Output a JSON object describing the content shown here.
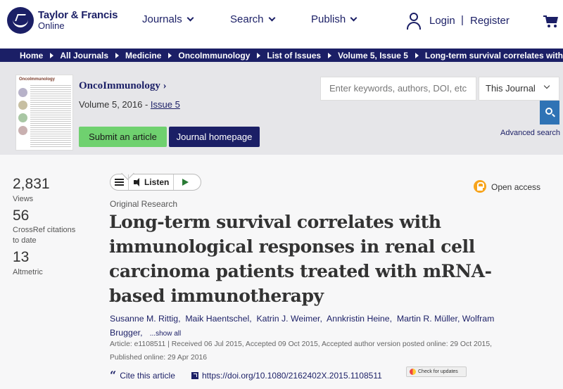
{
  "header": {
    "brand_line1": "Taylor & Francis",
    "brand_line2": "Online",
    "nav": [
      "Journals",
      "Search",
      "Publish"
    ],
    "login": "Login",
    "separator": "|",
    "register": "Register"
  },
  "breadcrumb": [
    "Home",
    "All Journals",
    "Medicine",
    "OncoImmunology",
    "List of Issues",
    "Volume 5, Issue 5",
    "Long-term survival correlates with i"
  ],
  "journal": {
    "cover_title": "OncoImmunology",
    "title": "OncoImmunology ›",
    "volume_text": "Volume 5, 2016 - ",
    "issue_link": "Issue 5",
    "submit_label": "Submit an article",
    "homepage_label": "Journal homepage"
  },
  "search": {
    "placeholder": "Enter keywords, authors, DOI, etc",
    "scope": "This Journal",
    "advanced": "Advanced search"
  },
  "metrics": [
    {
      "value": "2,831",
      "label": "Views"
    },
    {
      "value": "56",
      "label": "CrossRef citations to date"
    },
    {
      "value": "13",
      "label": "Altmetric"
    }
  ],
  "listen": {
    "label": "Listen"
  },
  "access": {
    "label": "Open access",
    "color": "#f7a41c"
  },
  "article": {
    "type": "Original Research",
    "title": "Long-term survival correlates with immunological responses in renal cell carcinoma patients treated with mRNA-based immunotherapy",
    "authors": [
      "Susanne M. Rittig",
      "Maik Haentschel",
      "Katrin J. Weimer",
      "Annkristin Heine",
      "Martin R. Müller",
      "Wolfram Brugger"
    ],
    "show_all": "...show all",
    "meta": "Article: e1108511 | Received 06 Jul 2015, Accepted 09 Oct 2015, Accepted author version posted online: 29 Oct 2015, Published online: 29 Apr 2016",
    "cite_label": "Cite this article",
    "doi": "https://doi.org/10.1080/2162402X.2015.1108511",
    "check_updates": "Check for updates"
  },
  "colors": {
    "brand": "#1b1f66",
    "submit": "#6fd16f",
    "search_button": "#2f73b5"
  }
}
